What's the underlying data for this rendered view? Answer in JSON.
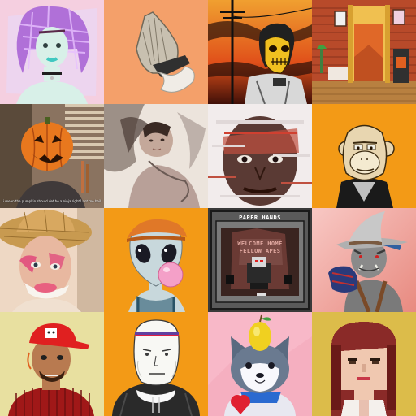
{
  "gallery": {
    "tiles": [
      {
        "subject": "purple-hair-woman",
        "bg": "#f2c4d8"
      },
      {
        "subject": "praying-hands",
        "bg": "#f4a06a"
      },
      {
        "subject": "skull-mask-sunset",
        "bg": "#e86a1a"
      },
      {
        "subject": "interior-room",
        "bg": "#c04020"
      },
      {
        "subject": "pumpkin-head",
        "bg": "#8a7360",
        "caption": "i mean the pumpkin should def be a ninja right? not me bail"
      },
      {
        "subject": "sepia-portrait",
        "bg": "#e8e0d8"
      },
      {
        "subject": "glitch-face",
        "bg": "#f2ecec"
      },
      {
        "subject": "bored-ape",
        "bg": "#f39a16"
      },
      {
        "subject": "straw-hat-person",
        "bg": "#f0d0b0"
      },
      {
        "subject": "alien-bubblegum",
        "bg": "#f39a16"
      },
      {
        "subject": "paper-hands-cartridge",
        "bg": "#2a2a2a",
        "title": "PAPER HANDS",
        "subtitle_lines": [
          "WELCOME HOME",
          "FELLOW APES"
        ]
      },
      {
        "subject": "orc-wizard-hat",
        "bg": "#f4c4c0"
      },
      {
        "subject": "red-cap-man",
        "bg": "#e8e0a0"
      },
      {
        "subject": "wojak-hoodie",
        "bg": "#f39a16"
      },
      {
        "subject": "husky-pear",
        "bg": "#f8b8c8"
      },
      {
        "subject": "pixel-woman",
        "bg": "#e0c050"
      }
    ]
  }
}
